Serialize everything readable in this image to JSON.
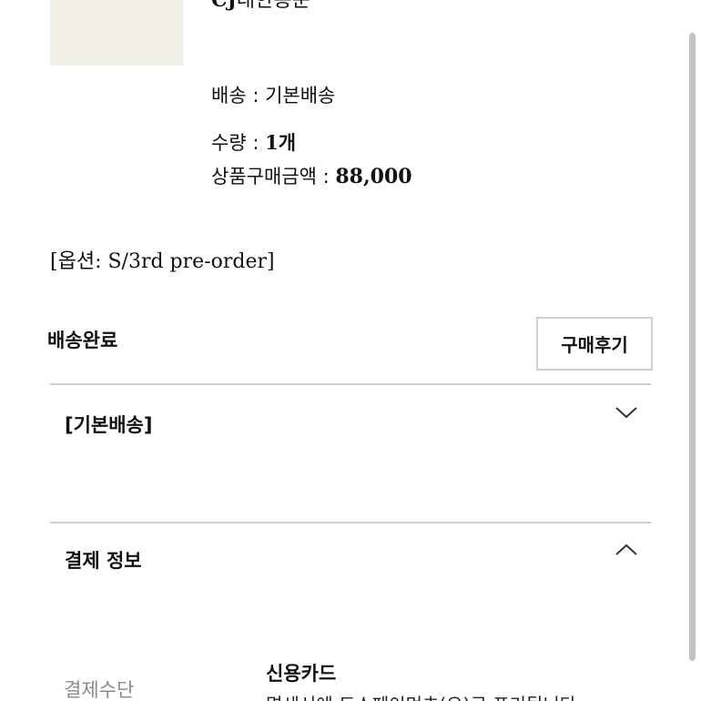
{
  "order_item": {
    "carrier_prefix": "CJ",
    "carrier_name": "대한통운",
    "shipping_label": "배송 : ",
    "shipping_value": "기본배송",
    "quantity_label": "수량 : ",
    "quantity_value": "1개",
    "price_label": "상품구매금액 : ",
    "price_value": "88,000",
    "option_text": "[옵션: S/3rd pre-order]"
  },
  "status": {
    "label": "배송완료",
    "review_button": "구매후기"
  },
  "sections": {
    "shipping": {
      "title": "[기본배송]",
      "icon": "chevron-down-icon"
    },
    "payment": {
      "title": "결제 정보",
      "icon": "chevron-up-icon"
    }
  },
  "payment": {
    "method_label": "결제수단",
    "method_value": "신용카드",
    "method_note": "명세서에 토스페이먼츠(으)로 표기됩니다"
  }
}
